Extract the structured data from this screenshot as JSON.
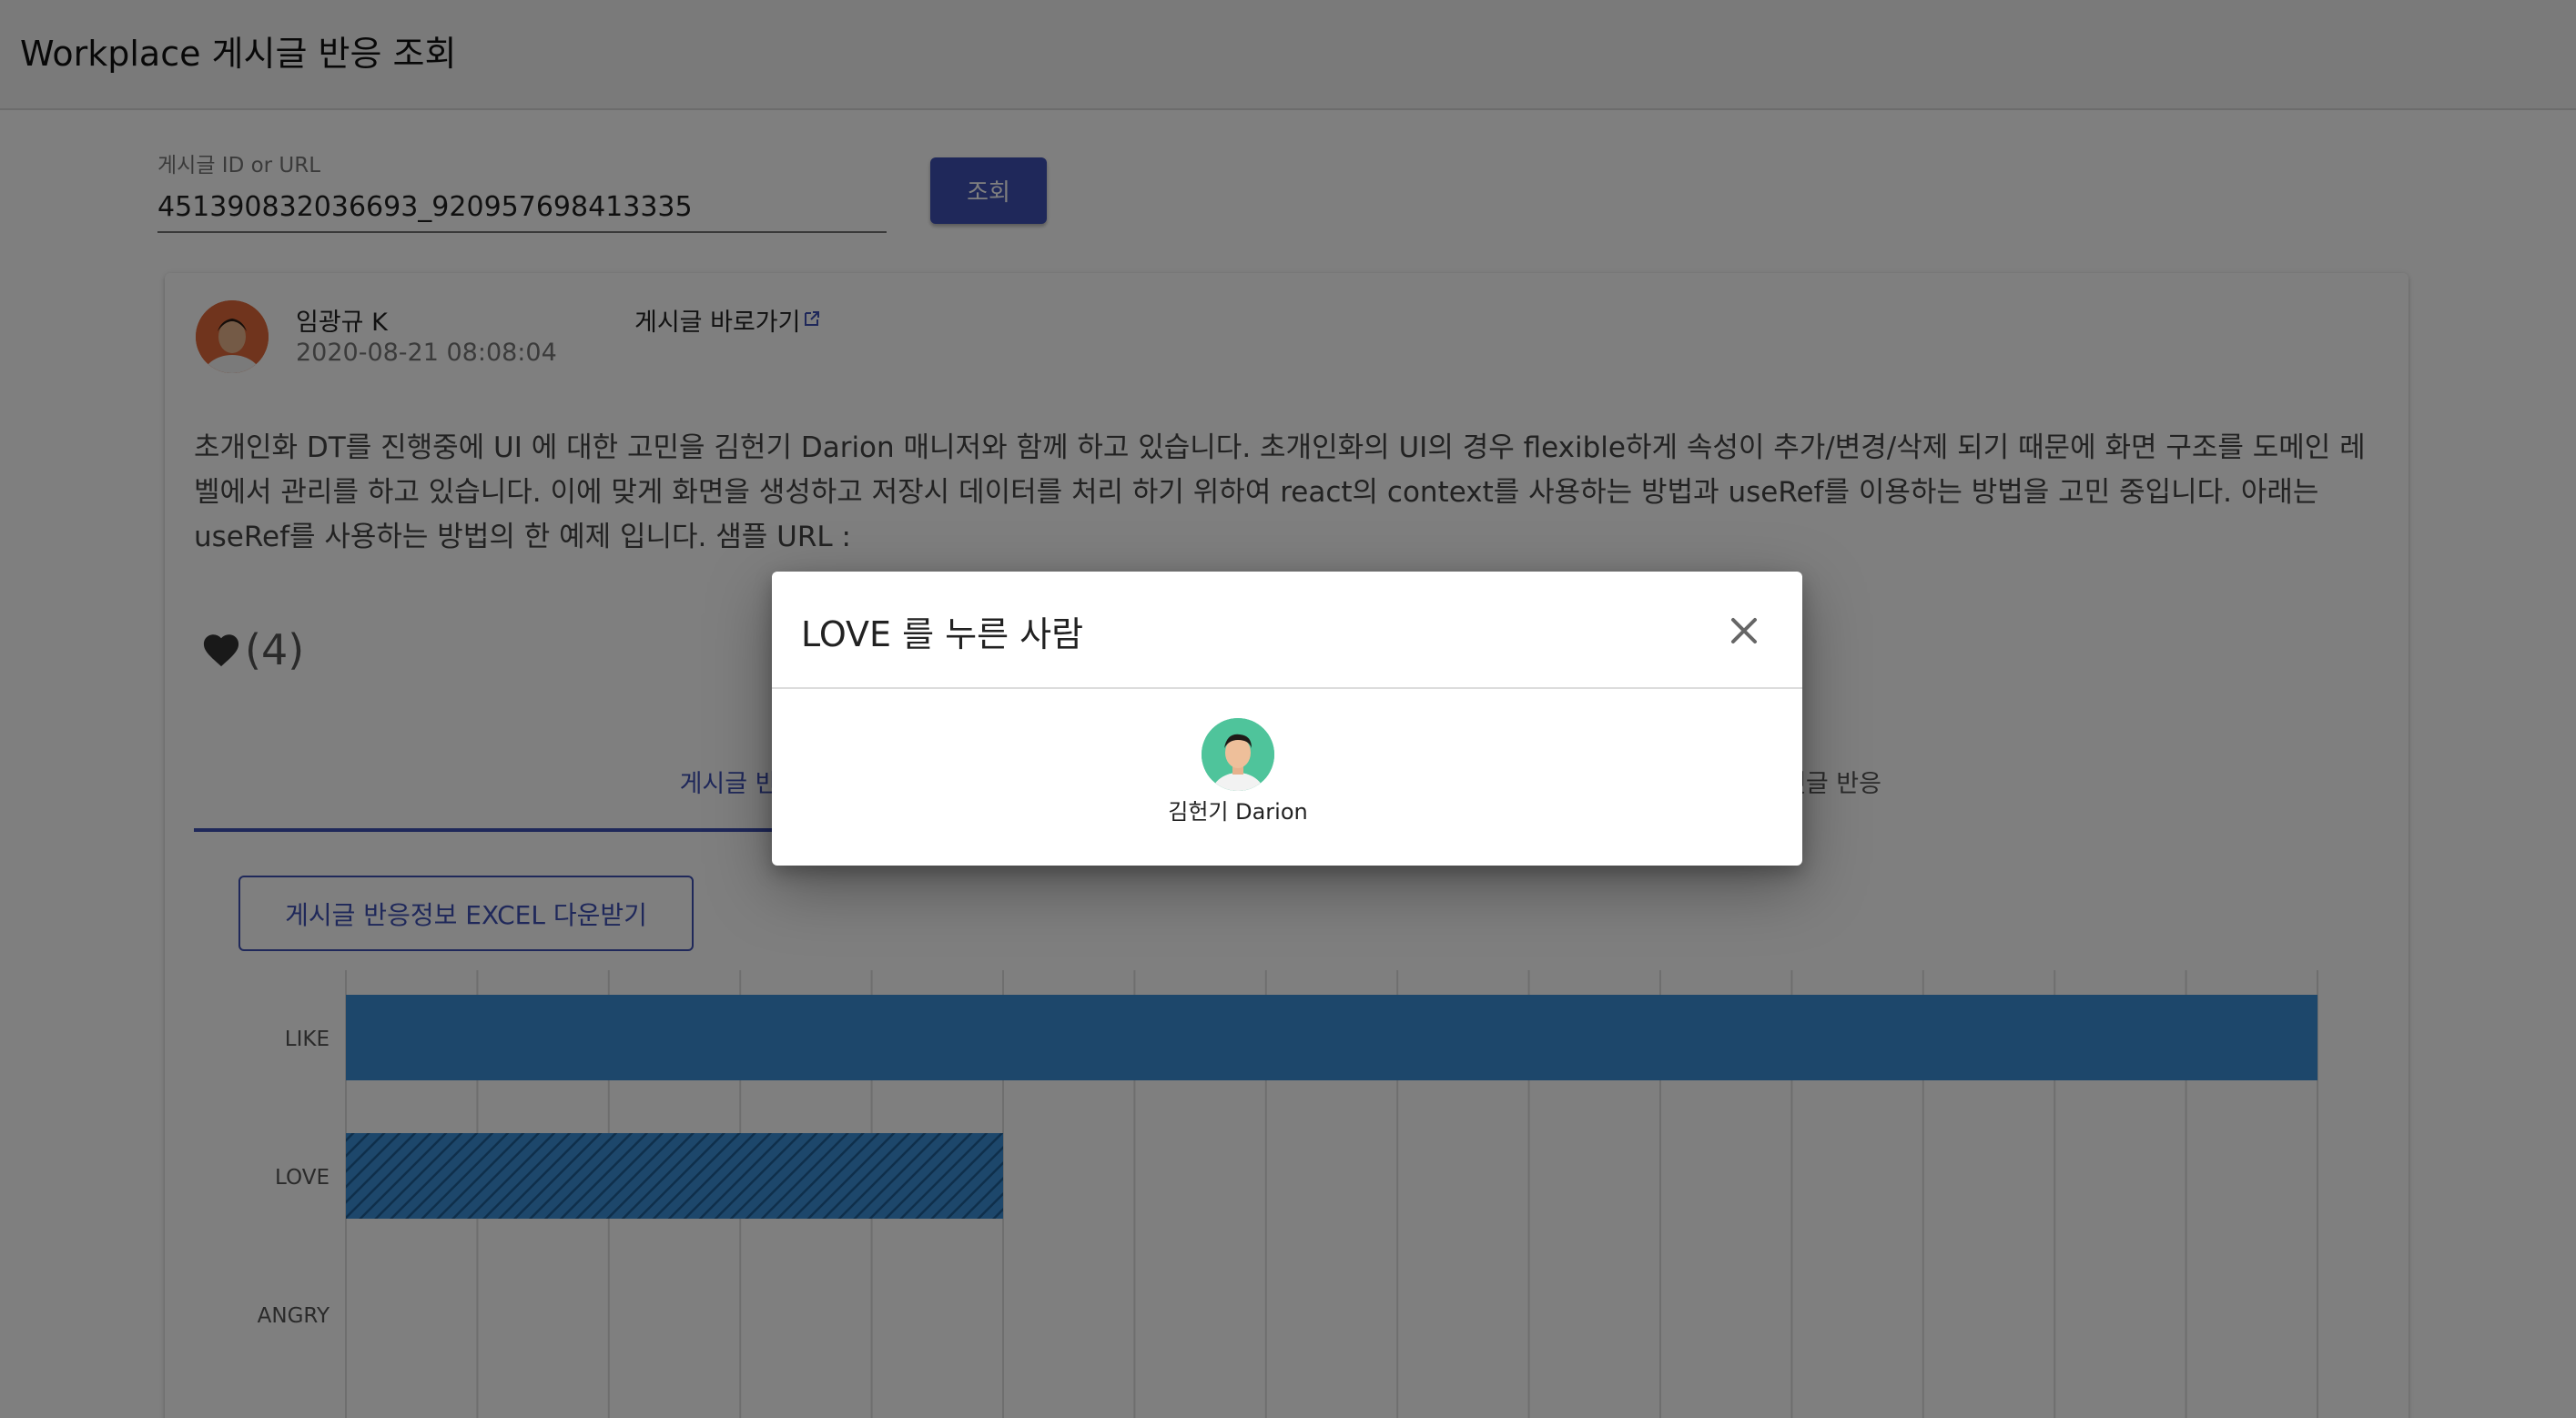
{
  "app": {
    "title": "Workplace 게시글 반응 조회"
  },
  "search": {
    "label": "게시글 ID or URL",
    "value": "451390832036693_920957698413335",
    "button_label": "조회"
  },
  "post": {
    "author_name": "임광규 K",
    "date": "2020-08-21 08:08:04",
    "link_label": "게시글 바로가기",
    "body": "초개인화 DT를 진행중에 UI 에 대한 고민을 김헌기 Darion 매니저와 함께 하고 있습니다. 초개인화의 UI의 경우 flexible하게 속성이 추가/변경/삭제 되기 때문에 화면 구조를 도메인 레벨에서 관리를 하고 있습니다. 이에 맞게 화면을 생성하고 저장시 데이터를 처리 하기 위하여 react의 context를 사용하는 방법과 useRef를 이용하는 방법을 고민 중입니다. 아래는 useRef를 사용하는 방법의 한 예제 입니다. 샘플 URL :",
    "reaction_summary": "(4)"
  },
  "tabs": [
    {
      "label": "게시글 반응"
    },
    {
      "label": "댓글 반응"
    }
  ],
  "excel_button_label": "게시글 반응정보 EXCEL 다운받기",
  "chart_data": {
    "type": "bar",
    "orientation": "horizontal",
    "categories": [
      "LIKE",
      "LOVE",
      "ANGRY"
    ],
    "values": [
      3,
      1,
      0
    ],
    "xlim": [
      0,
      3
    ],
    "grid": true,
    "colors": {
      "LIKE": "#3b8fd6",
      "LOVE": "#3b8fd6 (hatched)",
      "ANGRY": "#3b8fd6"
    }
  },
  "dialog": {
    "title": "LOVE 를 누른 사람",
    "users": [
      {
        "name": "김헌기 Darion"
      }
    ]
  },
  "colors": {
    "primary": "#3f51b5",
    "bar": "#3b8fd6",
    "overlay": "rgba(0,0,0,0.5)"
  }
}
